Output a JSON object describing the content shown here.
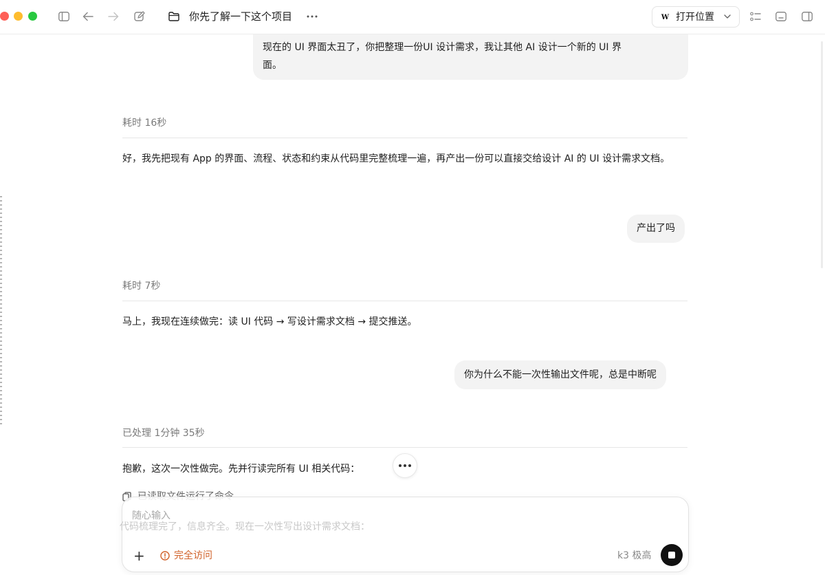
{
  "window": {
    "project_title": "你先了解一下这个项目",
    "open_location_label": "打开位置",
    "open_location_logo": "W"
  },
  "messages": [
    {
      "role": "user",
      "text_line1": "现在的 UI 界面太丑了，你把整理一份UI 设计需求，我让其他 AI 设计一个新的 UI 界",
      "text_line2": "面。"
    },
    {
      "role": "meta",
      "text": "耗时 16秒"
    },
    {
      "role": "assistant",
      "text": "好，我先把现有 App 的界面、流程、状态和约束从代码里完整梳理一遍，再产出一份可以直接交给设计 AI 的 UI 设计需求文档。"
    },
    {
      "role": "user",
      "text": "产出了吗"
    },
    {
      "role": "meta",
      "text": "耗时 7秒"
    },
    {
      "role": "assistant",
      "text": "马上，我现在连续做完：读 UI 代码 → 写设计需求文档 → 提交推送。"
    },
    {
      "role": "user",
      "text": "你为什么不能一次性输出文件呢，总是中断呢"
    },
    {
      "role": "meta",
      "text": "已处理 1分钟 35秒"
    },
    {
      "role": "assistant",
      "text": "抱歉，这次一次性做完。先并行读完所有 UI 相关代码："
    },
    {
      "role": "tool",
      "text": "已读取文件运行了命令"
    },
    {
      "role": "assistant_faded",
      "text": "代码梳理完了，信息齐全。现在一次性写出设计需求文档："
    }
  ],
  "composer": {
    "placeholder": "随心输入",
    "access_label": "完全访问",
    "model_label": "k3  极高"
  }
}
